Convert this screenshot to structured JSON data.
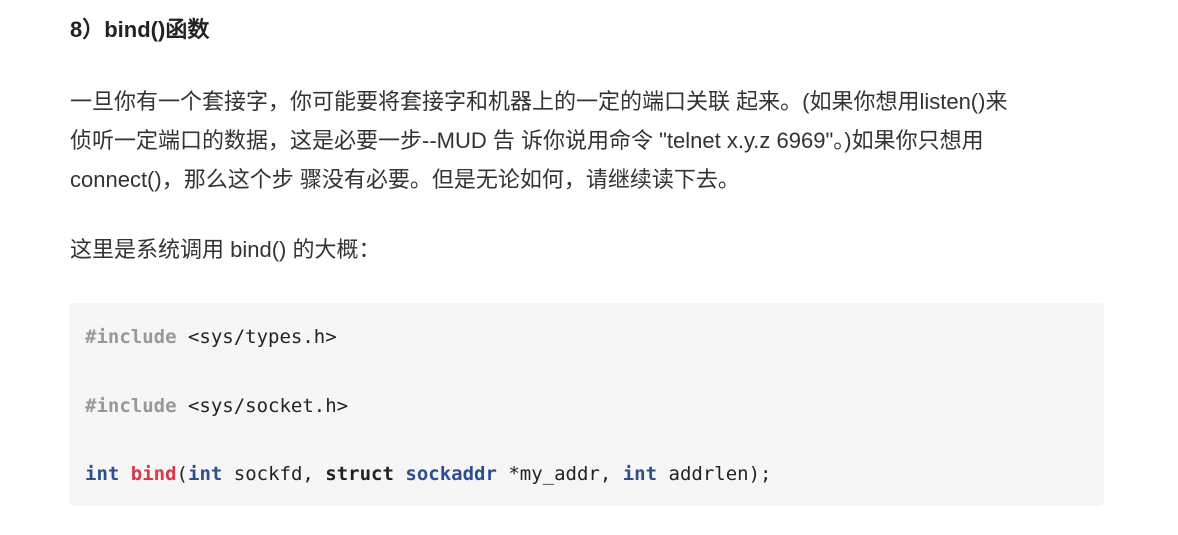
{
  "heading": "8）bind()函数",
  "paragraph1": {
    "lines": [
      "一旦你有一个套接字，你可能要将套接字和机器上的一定的端口关联 起来。(如果你想用listen()来",
      "侦听一定端口的数据，这是必要一步--MUD 告 诉你说用命令 \"telnet x.y.z 6969\"。)如果你只想用",
      "connect()，那么这个步 骤没有必要。但是无论如何，请继续读下去。"
    ]
  },
  "paragraph2": "这里是系统调用 bind() 的大概：",
  "code": {
    "line1": {
      "directive": "#include",
      "rest": " <sys/types.h>"
    },
    "line2": {
      "directive": "#include",
      "rest": " <sys/socket.h>"
    },
    "line3": {
      "t1": "int",
      "fname": "bind",
      "p1": "(",
      "t2": "int",
      "p2": " sockfd, ",
      "k1": "struct",
      "sp": " ",
      "t3": "sockaddr",
      "p3": " *my_addr, ",
      "t4": "int",
      "p4": " addrlen);"
    }
  }
}
